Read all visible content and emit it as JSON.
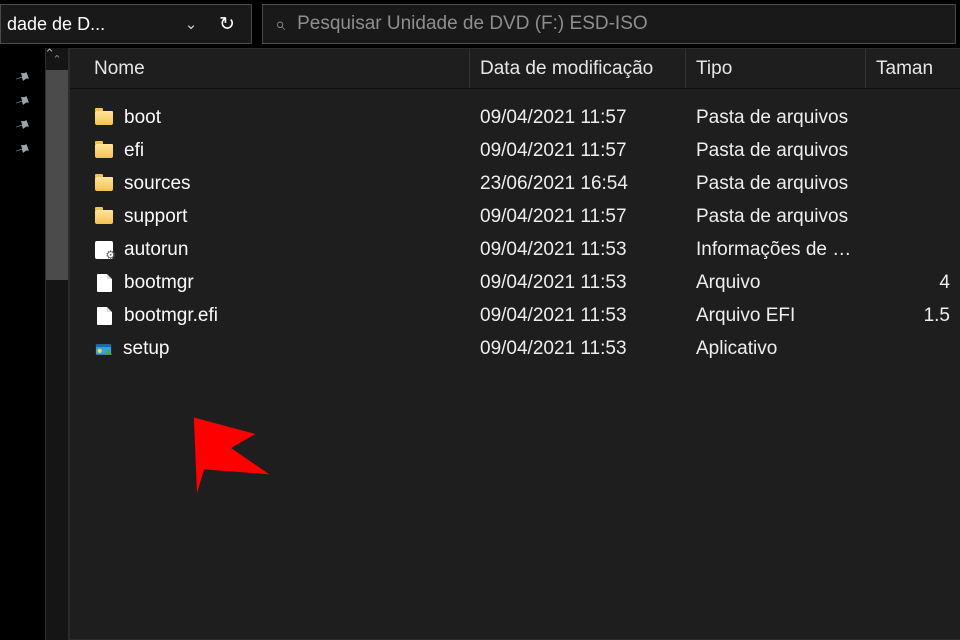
{
  "address": {
    "label": "dade de D..."
  },
  "search": {
    "placeholder": "Pesquisar Unidade de DVD (F:) ESD-ISO"
  },
  "columns": {
    "name": "Nome",
    "date": "Data de modificação",
    "type": "Tipo",
    "size": "Taman"
  },
  "rows": [
    {
      "icon": "folder",
      "name": "boot",
      "date": "09/04/2021 11:57",
      "type": "Pasta de arquivos",
      "size": ""
    },
    {
      "icon": "folder",
      "name": "efi",
      "date": "09/04/2021 11:57",
      "type": "Pasta de arquivos",
      "size": ""
    },
    {
      "icon": "folder",
      "name": "sources",
      "date": "23/06/2021 16:54",
      "type": "Pasta de arquivos",
      "size": ""
    },
    {
      "icon": "folder",
      "name": "support",
      "date": "09/04/2021 11:57",
      "type": "Pasta de arquivos",
      "size": ""
    },
    {
      "icon": "inf",
      "name": "autorun",
      "date": "09/04/2021 11:53",
      "type": "Informações de co...",
      "size": ""
    },
    {
      "icon": "file",
      "name": "bootmgr",
      "date": "09/04/2021 11:53",
      "type": "Arquivo",
      "size": "4"
    },
    {
      "icon": "file",
      "name": "bootmgr.efi",
      "date": "09/04/2021 11:53",
      "type": "Arquivo EFI",
      "size": "1.5"
    },
    {
      "icon": "exe",
      "name": "setup",
      "date": "09/04/2021 11:53",
      "type": "Aplicativo",
      "size": ""
    }
  ]
}
